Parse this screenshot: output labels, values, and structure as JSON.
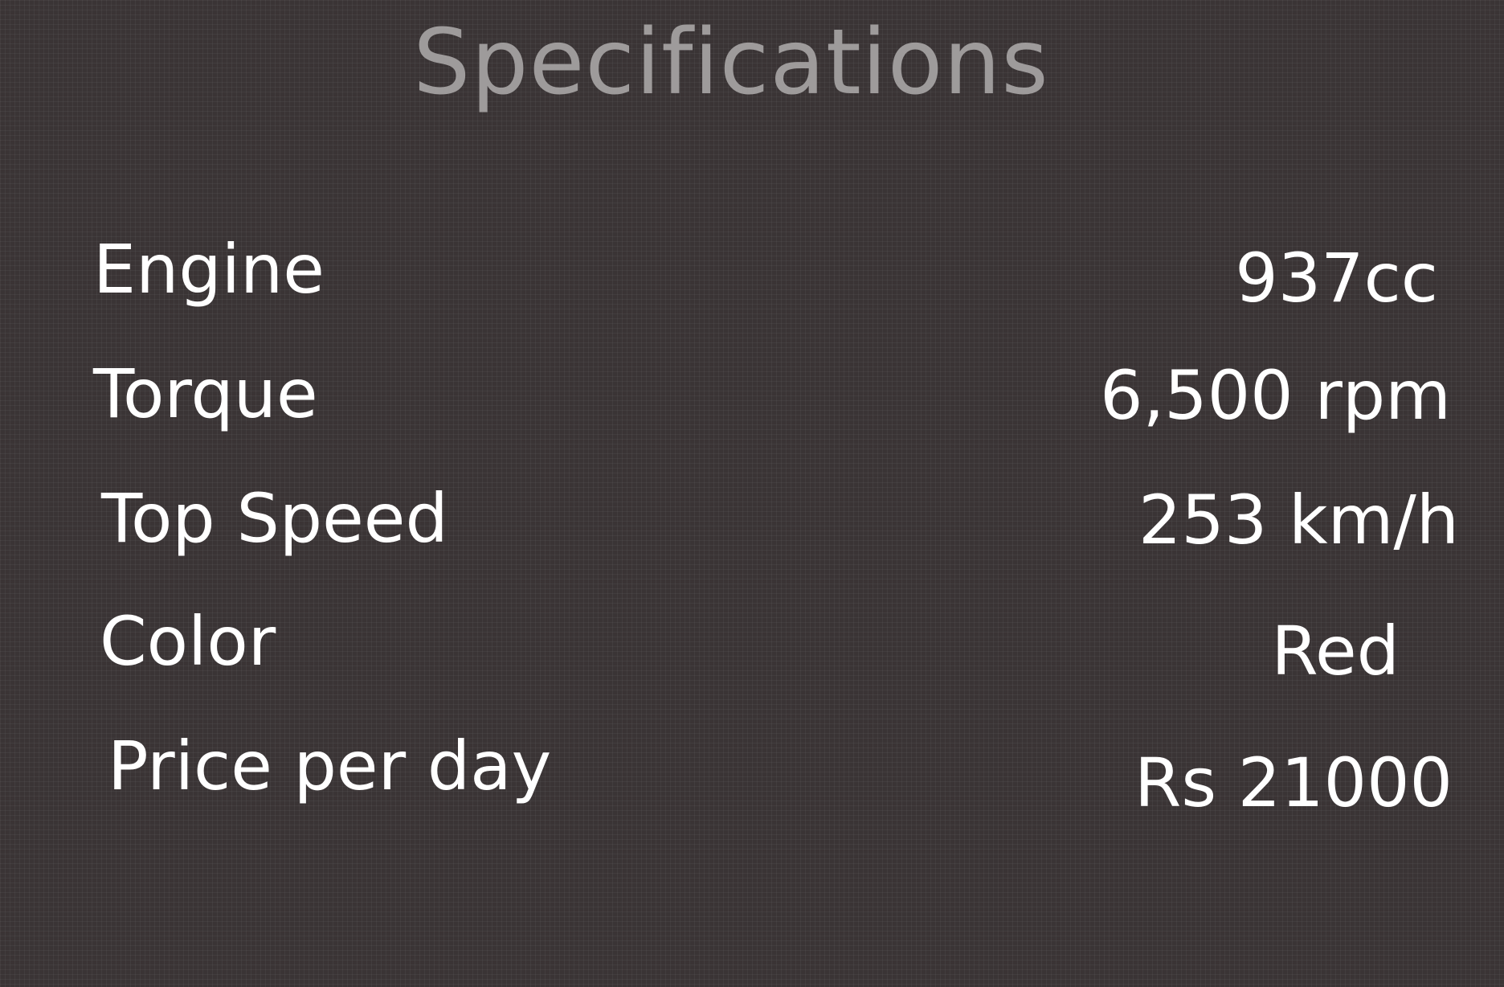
{
  "header": {
    "title": "Specifications"
  },
  "specs": [
    {
      "label": "Engine",
      "value": "937cc"
    },
    {
      "label": "Torque",
      "value": "6,500 rpm"
    },
    {
      "label": "Top Speed",
      "value": "253 km/h"
    },
    {
      "label": "Color",
      "value": "Red"
    },
    {
      "label": "Price per day",
      "value": "Rs 21000"
    }
  ]
}
